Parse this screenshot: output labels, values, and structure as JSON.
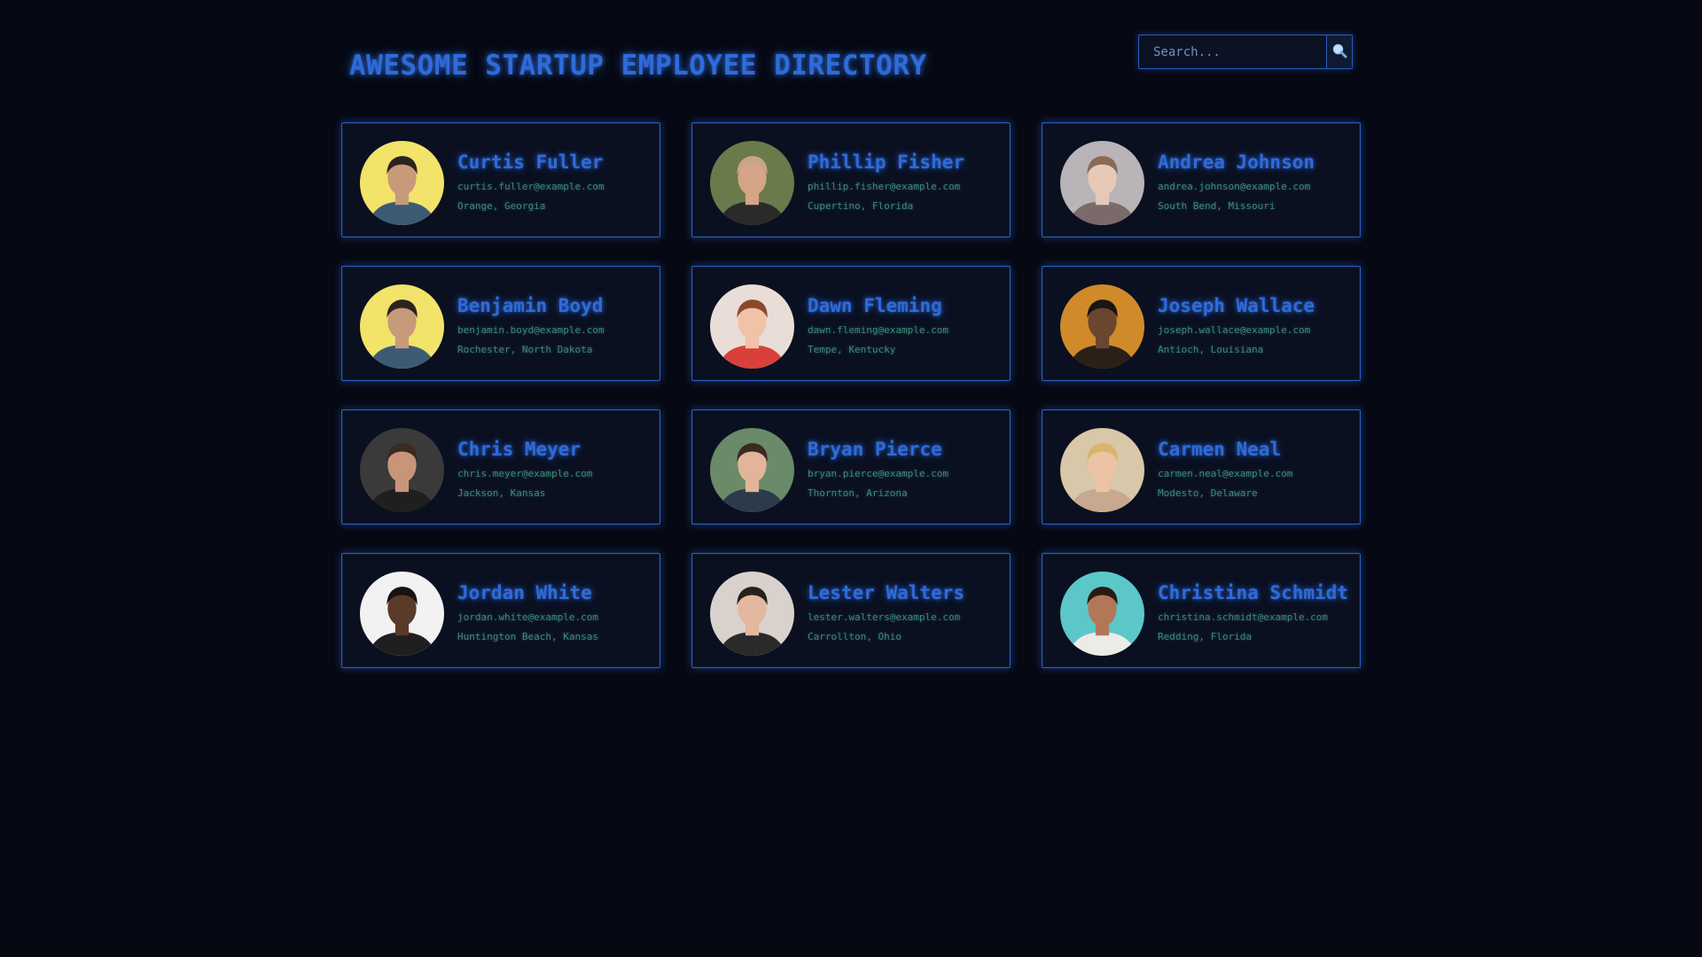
{
  "header": {
    "title": "AWESOME STARTUP EMPLOYEE DIRECTORY",
    "search_placeholder": "Search...",
    "search_icon": "magnifier-icon"
  },
  "colors": {
    "background": "#060913",
    "accent": "#2f6bd9",
    "secondary_text": "#3f8a78",
    "card_border": "#2a5cc0"
  },
  "employees": [
    {
      "name": "Curtis Fuller",
      "email": "curtis.fuller@example.com",
      "location": "Orange, Georgia",
      "avatar_bg": "#f2e36a",
      "skin": "#c79a7a",
      "hair": "#2b2320",
      "shirt": "#3d5a73"
    },
    {
      "name": "Phillip Fisher",
      "email": "phillip.fisher@example.com",
      "location": "Cupertino, Florida",
      "avatar_bg": "#6a7a4a",
      "skin": "#d6a487",
      "hair": "#c9a488",
      "shirt": "#2a2a2a"
    },
    {
      "name": "Andrea Johnson",
      "email": "andrea.johnson@example.com",
      "location": "South Bend, Missouri",
      "avatar_bg": "#b8b4b8",
      "skin": "#e7c9b8",
      "hair": "#8a6a55",
      "shirt": "#7a6a6a"
    },
    {
      "name": "Benjamin Boyd",
      "email": "benjamin.boyd@example.com",
      "location": "Rochester, North Dakota",
      "avatar_bg": "#f2e36a",
      "skin": "#c79a7a",
      "hair": "#2b2320",
      "shirt": "#3d5a73"
    },
    {
      "name": "Dawn Fleming",
      "email": "dawn.fleming@example.com",
      "location": "Tempe, Kentucky",
      "avatar_bg": "#e9ddd8",
      "skin": "#f0c3a8",
      "hair": "#8a4a2a",
      "shirt": "#d9403a"
    },
    {
      "name": "Joseph Wallace",
      "email": "joseph.wallace@example.com",
      "location": "Antioch, Louisiana",
      "avatar_bg": "#d08a2a",
      "skin": "#6a4530",
      "hair": "#1a1412",
      "shirt": "#2a2018"
    },
    {
      "name": "Chris Meyer",
      "email": "chris.meyer@example.com",
      "location": "Jackson, Kansas",
      "avatar_bg": "#3a3a3a",
      "skin": "#c9957a",
      "hair": "#3a2a20",
      "shirt": "#1f1f1f"
    },
    {
      "name": "Bryan Pierce",
      "email": "bryan.pierce@example.com",
      "location": "Thornton, Arizona",
      "avatar_bg": "#6a8a6a",
      "skin": "#e2b49a",
      "hair": "#3a2a22",
      "shirt": "#2d3a4a"
    },
    {
      "name": "Carmen Neal",
      "email": "carmen.neal@example.com",
      "location": "Modesto, Delaware",
      "avatar_bg": "#d8c7a8",
      "skin": "#ecc3a4",
      "hair": "#d7b56a",
      "shirt": "#c8a890"
    },
    {
      "name": "Jordan White",
      "email": "jordan.white@example.com",
      "location": "Huntington Beach, Kansas",
      "avatar_bg": "#f2f2f2",
      "skin": "#5a3a28",
      "hair": "#1a1210",
      "shirt": "#1f1f1f"
    },
    {
      "name": "Lester Walters",
      "email": "lester.walters@example.com",
      "location": "Carrollton, Ohio",
      "avatar_bg": "#d9d2cc",
      "skin": "#e2b89e",
      "hair": "#2a201a",
      "shirt": "#2a2a2a"
    },
    {
      "name": "Christina Schmidt",
      "email": "christina.schmidt@example.com",
      "location": "Redding, Florida",
      "avatar_bg": "#5cc7c9",
      "skin": "#b07858",
      "hair": "#2a1a14",
      "shirt": "#ecebe8"
    }
  ]
}
